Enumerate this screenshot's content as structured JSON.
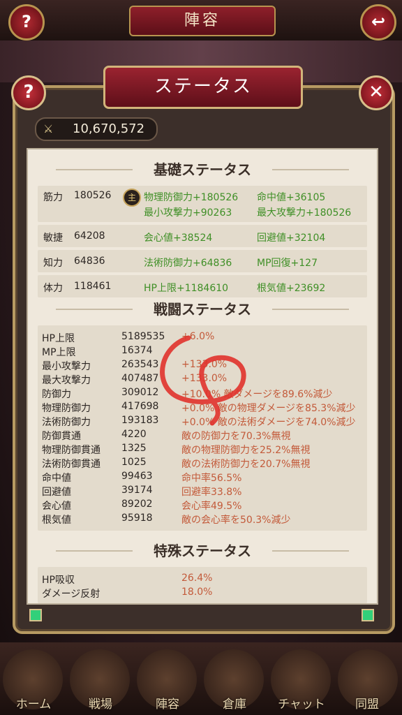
{
  "header": {
    "title": "陣容",
    "help": "?",
    "back": "↩"
  },
  "panel": {
    "title": "ステータス",
    "help": "?",
    "close": "✕"
  },
  "power": {
    "icon": "swords-icon",
    "value": "10,670,572"
  },
  "basic": {
    "title": "基礎ステータス",
    "rows": [
      {
        "label": "筋力",
        "value": "180526",
        "badge": "主",
        "bonus": [
          "物理防御力+180526",
          "命中値+36105",
          "最小攻撃力+90263",
          "最大攻撃力+180526"
        ]
      },
      {
        "label": "敏捷",
        "value": "64208",
        "bonus": [
          "会心値+38524",
          "回避値+32104"
        ]
      },
      {
        "label": "知力",
        "value": "64836",
        "bonus": [
          "法術防御力+64836",
          "MP回復+127"
        ]
      },
      {
        "label": "体力",
        "value": "118461",
        "bonus": [
          "HP上限+1184610",
          "根気値+23692"
        ]
      }
    ]
  },
  "battle": {
    "title": "戦闘ステータス",
    "rows": [
      {
        "label": "HP上限",
        "value": "5189535",
        "note": "+6.0%"
      },
      {
        "label": "MP上限",
        "value": "16374",
        "note": ""
      },
      {
        "label": "最小攻撃力",
        "value": "263543",
        "note": "+133.0%"
      },
      {
        "label": "最大攻撃力",
        "value": "407487",
        "note": "+133.0%"
      },
      {
        "label": "防御力",
        "value": "309012",
        "note": "+10.0% 敵ダメージを89.6%減少"
      },
      {
        "label": "物理防御力",
        "value": "417698",
        "note": "+0.0% 敵の物理ダメージを85.3%減少"
      },
      {
        "label": "法術防御力",
        "value": "193183",
        "note": "+0.0% 敵の法術ダメージを74.0%減少"
      },
      {
        "label": "防御貫通",
        "value": "4220",
        "note": "敵の防御力を70.3%無視"
      },
      {
        "label": "物理防御貫通",
        "value": "1325",
        "note": "敵の物理防御力を25.2%無視"
      },
      {
        "label": "法術防御貫通",
        "value": "1025",
        "note": "敵の法術防御力を20.7%無視"
      },
      {
        "label": "命中値",
        "value": "99463",
        "note": "命中率56.5%"
      },
      {
        "label": "回避値",
        "value": "39174",
        "note": "回避率33.8%"
      },
      {
        "label": "会心値",
        "value": "89202",
        "note": "会心率49.5%"
      },
      {
        "label": "根気値",
        "value": "95918",
        "note": "敵の会心率を50.3%減少"
      }
    ]
  },
  "special": {
    "title": "特殊ステータス",
    "rows": [
      {
        "label": "HP吸収",
        "value": "26.4%"
      },
      {
        "label": "ダメージ反射",
        "value": "18.0%"
      }
    ]
  },
  "nav": [
    {
      "label": "ホーム"
    },
    {
      "label": "戦場"
    },
    {
      "label": "陣容"
    },
    {
      "label": "倉庫"
    },
    {
      "label": "チャット"
    },
    {
      "label": "同盟"
    }
  ],
  "colors": {
    "accent": "#8e1f2a",
    "bonus_green": "#3f8f26",
    "note_red": "#c35a3a",
    "scribble": "#e0322c"
  }
}
